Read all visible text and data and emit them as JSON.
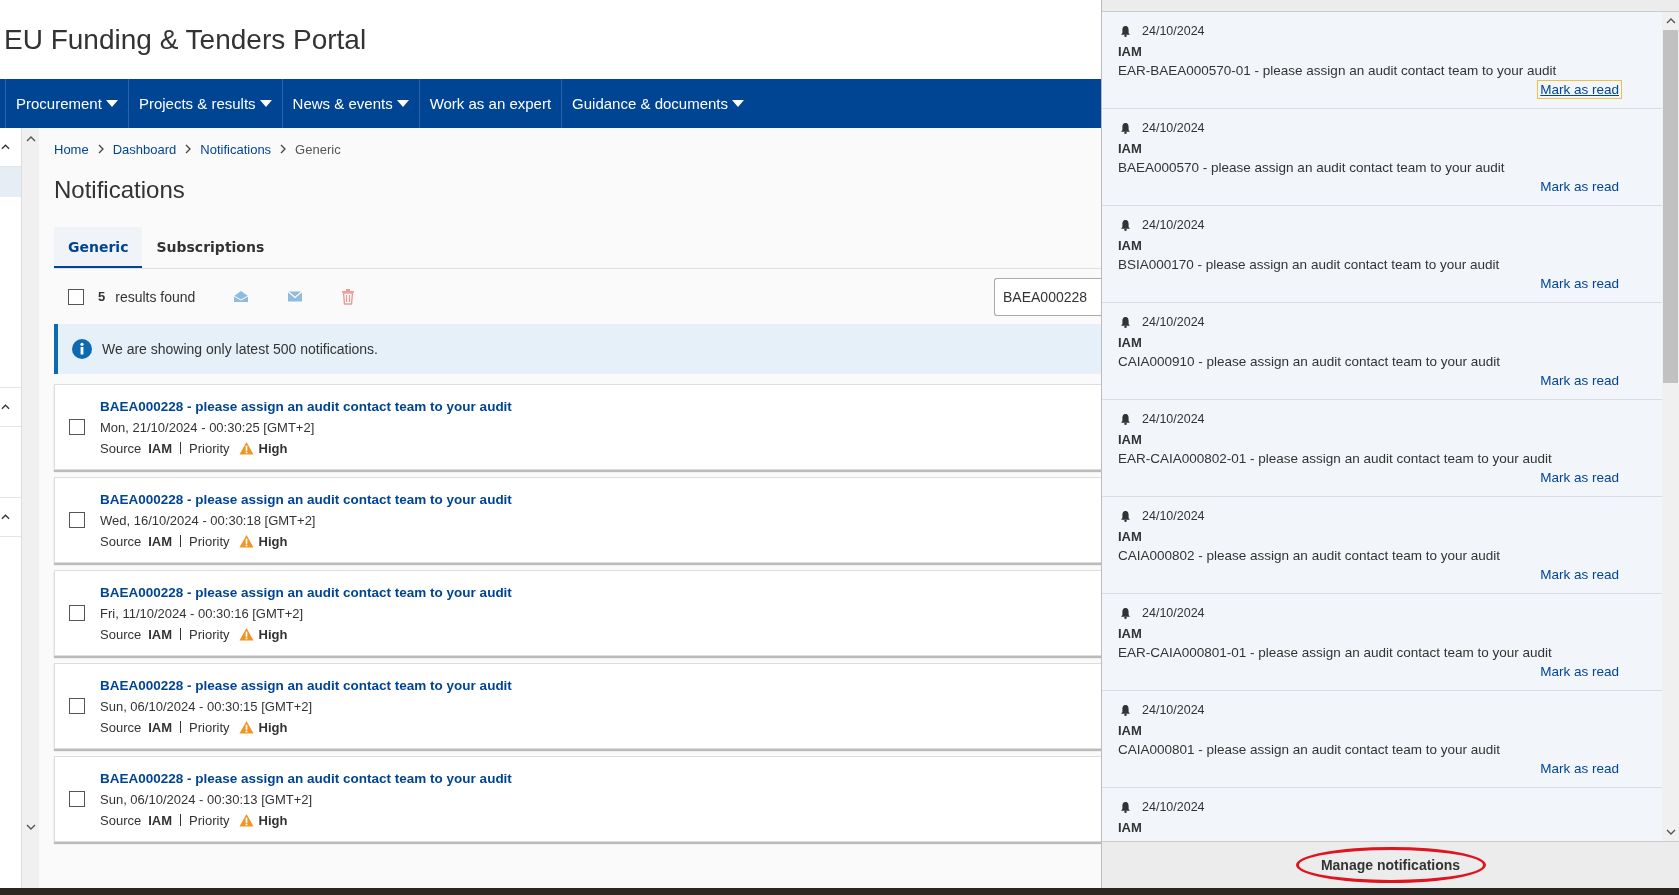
{
  "header": {
    "title": "EU Funding & Tenders Portal"
  },
  "nav": [
    {
      "label": "Procurement",
      "dropdown": true
    },
    {
      "label": "Projects & results",
      "dropdown": true
    },
    {
      "label": "News & events",
      "dropdown": true
    },
    {
      "label": "Work as an expert",
      "dropdown": false
    },
    {
      "label": "Guidance & documents",
      "dropdown": true
    }
  ],
  "breadcrumb": [
    {
      "label": "Home",
      "current": false
    },
    {
      "label": "Dashboard",
      "current": false
    },
    {
      "label": "Notifications",
      "current": false
    },
    {
      "label": "Generic",
      "current": true
    }
  ],
  "page_title": "Notifications",
  "tabs": [
    {
      "label": "Generic",
      "selected": true
    },
    {
      "label": "Subscriptions",
      "selected": false
    }
  ],
  "toolbar": {
    "select_all_checked": false,
    "count": "5",
    "count_label": "results found",
    "search": {
      "value": "BAEA000228"
    }
  },
  "info_banner": "We are showing only latest 500 notifications.",
  "notifications": [
    {
      "title": "BAEA000228 - please assign an audit contact team to your audit",
      "date": "Mon, 21/10/2024 - 00:30:25 [GMT+2]",
      "source_label": "Source",
      "source": "IAM",
      "priority_label": "Priority",
      "priority": "High",
      "checked": false
    },
    {
      "title": "BAEA000228 - please assign an audit contact team to your audit",
      "date": "Wed, 16/10/2024 - 00:30:18 [GMT+2]",
      "source_label": "Source",
      "source": "IAM",
      "priority_label": "Priority",
      "priority": "High",
      "checked": false
    },
    {
      "title": "BAEA000228 - please assign an audit contact team to your audit",
      "date": "Fri, 11/10/2024 - 00:30:16 [GMT+2]",
      "source_label": "Source",
      "source": "IAM",
      "priority_label": "Priority",
      "priority": "High",
      "checked": false
    },
    {
      "title": "BAEA000228 - please assign an audit contact team to your audit",
      "date": "Sun, 06/10/2024 - 00:30:15 [GMT+2]",
      "source_label": "Source",
      "source": "IAM",
      "priority_label": "Priority",
      "priority": "High",
      "checked": false
    },
    {
      "title": "BAEA000228 - please assign an audit contact team to your audit",
      "date": "Sun, 06/10/2024 - 00:30:13 [GMT+2]",
      "source_label": "Source",
      "source": "IAM",
      "priority_label": "Priority",
      "priority": "High",
      "checked": false
    }
  ],
  "panel": {
    "items": [
      {
        "date": "24/10/2024",
        "source": "IAM",
        "message": "EAR-BAEA000570-01 - please assign an audit contact team to your audit",
        "action": "Mark as read",
        "focused": true
      },
      {
        "date": "24/10/2024",
        "source": "IAM",
        "message": "BAEA000570 - please assign an audit contact team to your audit",
        "action": "Mark as read",
        "focused": false
      },
      {
        "date": "24/10/2024",
        "source": "IAM",
        "message": "BSIA000170 - please assign an audit contact team to your audit",
        "action": "Mark as read",
        "focused": false
      },
      {
        "date": "24/10/2024",
        "source": "IAM",
        "message": "CAIA000910 - please assign an audit contact team to your audit",
        "action": "Mark as read",
        "focused": false
      },
      {
        "date": "24/10/2024",
        "source": "IAM",
        "message": "EAR-CAIA000802-01 - please assign an audit contact team to your audit",
        "action": "Mark as read",
        "focused": false
      },
      {
        "date": "24/10/2024",
        "source": "IAM",
        "message": "CAIA000802 - please assign an audit contact team to your audit",
        "action": "Mark as read",
        "focused": false
      },
      {
        "date": "24/10/2024",
        "source": "IAM",
        "message": "EAR-CAIA000801-01 - please assign an audit contact team to your audit",
        "action": "Mark as read",
        "focused": false
      },
      {
        "date": "24/10/2024",
        "source": "IAM",
        "message": "CAIA000801 - please assign an audit contact team to your audit",
        "action": "Mark as read",
        "focused": false
      },
      {
        "date": "24/10/2024",
        "source": "IAM"
      }
    ],
    "footer": "Manage notifications",
    "footer_circled": true
  }
}
